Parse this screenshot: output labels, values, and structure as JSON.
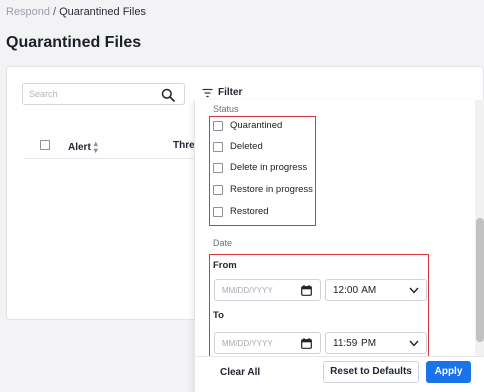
{
  "breadcrumb": {
    "parent": "Respond",
    "separator": "/",
    "current": "Quarantined Files"
  },
  "page_title": "Quarantined Files",
  "search": {
    "placeholder": "Search",
    "value": ""
  },
  "filter_label": "Filter",
  "table": {
    "columns": [
      "Alert",
      "Threa"
    ]
  },
  "filter_panel": {
    "status_label": "Status",
    "status_options": [
      "Quarantined",
      "Deleted",
      "Delete in progress",
      "Restore in progress",
      "Restored"
    ],
    "date_label": "Date",
    "from_label": "From",
    "to_label": "To",
    "from_date_placeholder": "MM/DD/YYYY",
    "to_date_placeholder": "MM/DD/YYYY",
    "from_time": "12:00  AM",
    "to_time": "11:59  PM",
    "clear_label": "Clear All",
    "reset_label": "Reset to Defaults",
    "apply_label": "Apply"
  },
  "colors": {
    "accent": "#1a73e8",
    "highlight": "#d9363e"
  }
}
